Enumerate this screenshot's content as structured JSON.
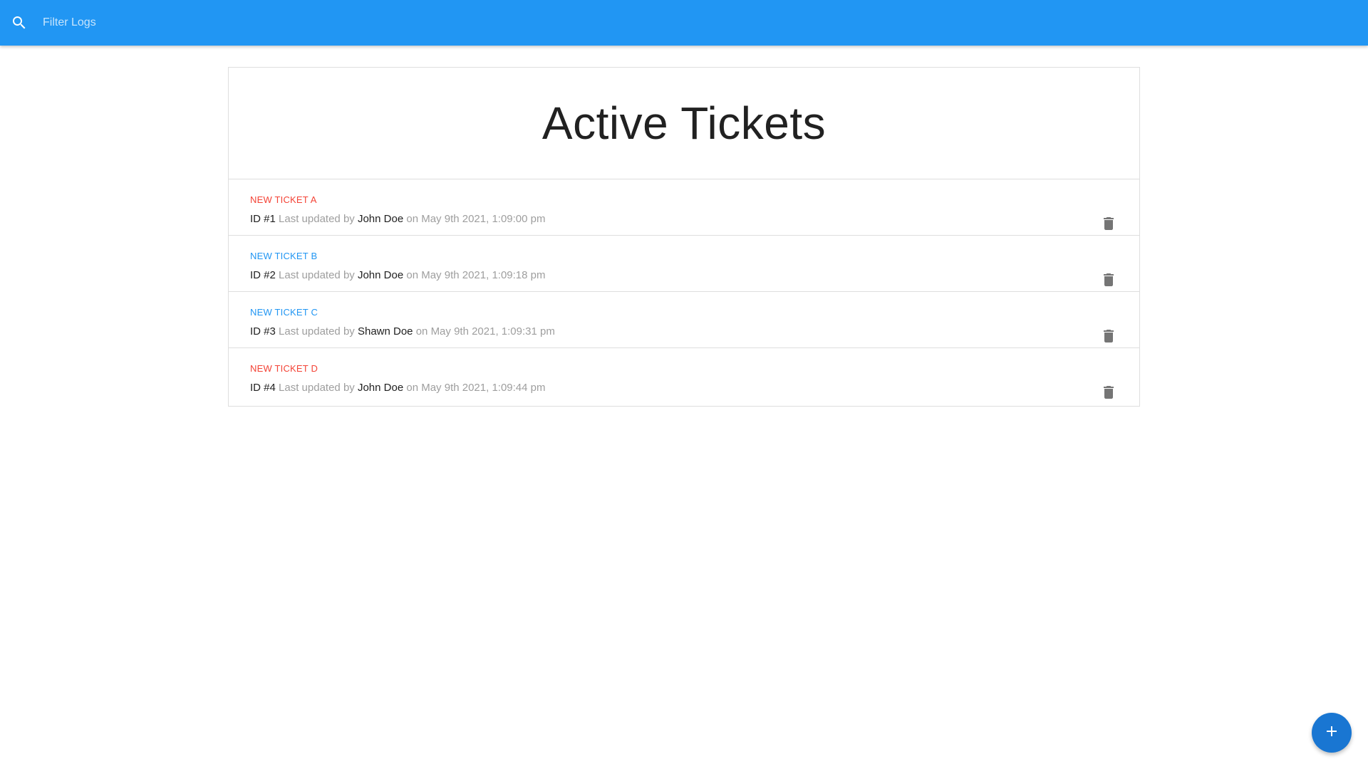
{
  "search": {
    "placeholder": "Filter Logs",
    "icon": "search-icon"
  },
  "colors": {
    "appbar": "#2196f3",
    "fab": "#1976d2",
    "status_red": "#f44336",
    "status_blue": "#2196f3"
  },
  "card": {
    "title": "Active Tickets"
  },
  "tickets": [
    {
      "name": "NEW TICKET A",
      "color": "#f44336",
      "id": "ID #1",
      "updated_label": "Last updated by",
      "user": "John Doe",
      "on_label": "on",
      "timestamp": "May 9th 2021, 1:09:00 pm",
      "action_icon": "delete-icon"
    },
    {
      "name": "NEW TICKET B",
      "color": "#2196f3",
      "id": "ID #2",
      "updated_label": "Last updated by",
      "user": "John Doe",
      "on_label": "on",
      "timestamp": "May 9th 2021, 1:09:18 pm",
      "action_icon": "delete-icon"
    },
    {
      "name": "NEW TICKET C",
      "color": "#2196f3",
      "id": "ID #3",
      "updated_label": "Last updated by",
      "user": "Shawn Doe",
      "on_label": "on",
      "timestamp": "May 9th 2021, 1:09:31 pm",
      "action_icon": "delete-icon"
    },
    {
      "name": "NEW TICKET D",
      "color": "#f44336",
      "id": "ID #4",
      "updated_label": "Last updated by",
      "user": "John Doe",
      "on_label": "on",
      "timestamp": "May 9th 2021, 1:09:44 pm",
      "action_icon": "delete-icon"
    }
  ],
  "fab": {
    "icon": "plus-icon"
  }
}
